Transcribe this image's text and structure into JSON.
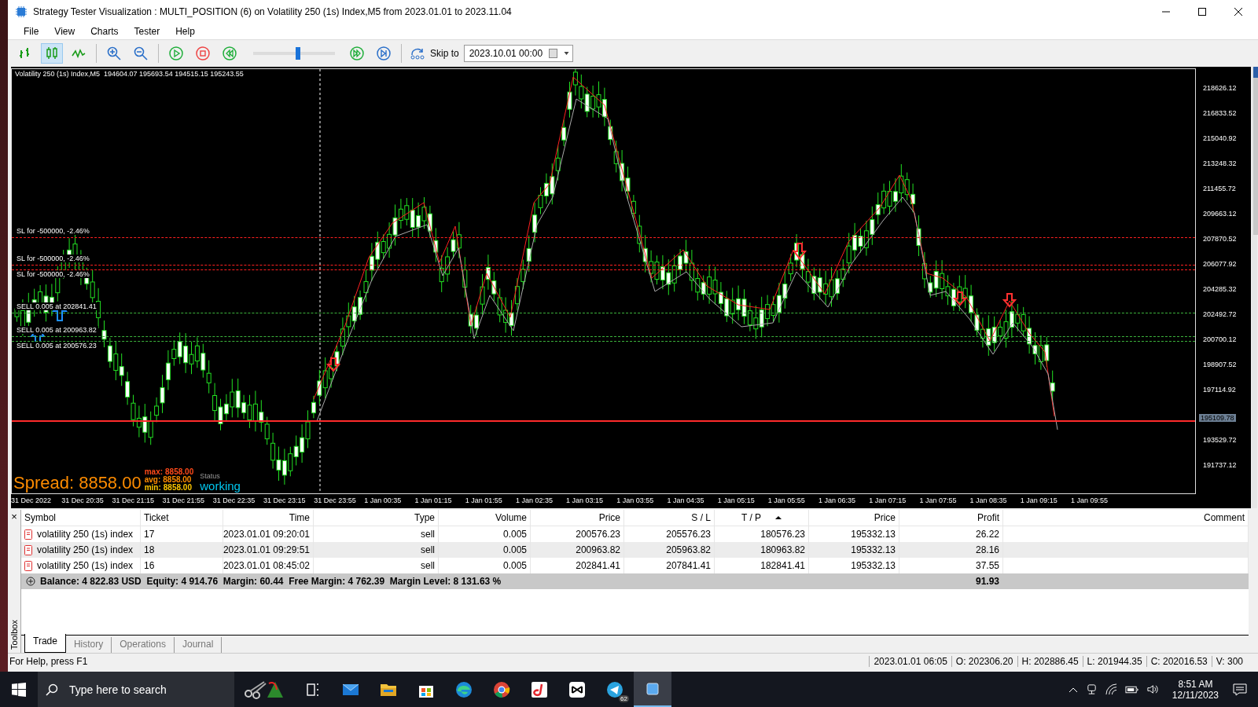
{
  "window": {
    "title": "Strategy Tester Visualization : MULTI_POSITION (6) on Volatility 250 (1s) Index,M5 from 2023.01.01 to 2023.11.04"
  },
  "menu": [
    "File",
    "View",
    "Charts",
    "Tester",
    "Help"
  ],
  "toolbar": {
    "items": [
      {
        "kind": "bars",
        "selected": false
      },
      {
        "kind": "candles",
        "selected": true
      },
      {
        "kind": "line",
        "selected": false
      },
      {
        "kind": "zoom-in"
      },
      {
        "kind": "zoom-out"
      },
      {
        "kind": "play"
      },
      {
        "kind": "stop"
      },
      {
        "kind": "rewind"
      },
      {
        "kind": "slider",
        "level": 0.55
      },
      {
        "kind": "fast-forward"
      },
      {
        "kind": "step-end"
      }
    ],
    "skip_label": "Skip to",
    "skip_date": "2023.10.01 00:00"
  },
  "chart": {
    "header": "Volatility 250 (1s) Index,M5  194604.07 195693.54 194515.15 195243.55",
    "levels": [
      {
        "label": "SL for -500000, -2.46%",
        "color": "#ff2020"
      },
      {
        "label": "SL for -500000, -2.46%",
        "color": "#ff2020"
      },
      {
        "label": "SL for -500000, -2.46%",
        "color": "#ff2020"
      },
      {
        "label": "SELL 0.005 at 202841.41",
        "color": "#3cb43c"
      },
      {
        "label": "SELL 0.005 at 200963.82",
        "color": "#3cb43c"
      },
      {
        "label": "SELL 0.005 at 200576.23",
        "color": "#3cb43c"
      }
    ],
    "current_price": "195109.78",
    "spread": "Spread: 8858.00",
    "stats": [
      {
        "label": "max:",
        "value": "8858.00",
        "color": "#ff4a1a"
      },
      {
        "label": "avg:",
        "value": "8858.00",
        "color": "#ff8c00"
      },
      {
        "label": "min:",
        "value": "8858.00",
        "color": "#ffc800"
      }
    ],
    "status_label": "Status",
    "status": "working",
    "y_ticks": [
      "218626.12",
      "216833.52",
      "215040.92",
      "213248.32",
      "211455.72",
      "209663.12",
      "207870.52",
      "206077.92",
      "204285.32",
      "202492.72",
      "200700.12",
      "198907.52",
      "197114.92",
      "193529.72",
      "191737.12"
    ],
    "x_ticks": [
      "31 Dec 2022",
      "31 Dec 20:35",
      "31 Dec 21:15",
      "31 Dec 21:55",
      "31 Dec 22:35",
      "31 Dec 23:15",
      "31 Dec 23:55",
      "1 Jan 00:35",
      "1 Jan 01:15",
      "1 Jan 01:55",
      "1 Jan 02:35",
      "1 Jan 03:15",
      "1 Jan 03:55",
      "1 Jan 04:35",
      "1 Jan 05:15",
      "1 Jan 05:55",
      "1 Jan 06:35",
      "1 Jan 07:15",
      "1 Jan 07:55",
      "1 Jan 08:35",
      "1 Jan 09:15",
      "1 Jan 09:55"
    ]
  },
  "toolbox": {
    "close": "×",
    "title": "Toolbox",
    "columns": [
      {
        "label": "Symbol",
        "sorted": false
      },
      {
        "label": "Ticket",
        "sorted": false
      },
      {
        "label": "Time",
        "sorted": false
      },
      {
        "label": "Type",
        "sorted": false
      },
      {
        "label": "Volume",
        "sorted": false
      },
      {
        "label": "Price",
        "sorted": false
      },
      {
        "label": "S / L",
        "sorted": false
      },
      {
        "label": "T / P",
        "sorted": true
      },
      {
        "label": "Price",
        "sorted": false
      },
      {
        "label": "Profit",
        "sorted": false
      },
      {
        "label": "Comment",
        "sorted": false
      }
    ],
    "rows": [
      [
        "volatility 250 (1s) index",
        "17",
        "2023.01.01 09:20:01",
        "sell",
        "0.005",
        "200576.23",
        "205576.23",
        "180576.23",
        "195332.13",
        "26.22"
      ],
      [
        "volatility 250 (1s) index",
        "18",
        "2023.01.01 09:29:51",
        "sell",
        "0.005",
        "200963.82",
        "205963.82",
        "180963.82",
        "195332.13",
        "28.16"
      ],
      [
        "volatility 250 (1s) index",
        "16",
        "2023.01.01 08:45:02",
        "sell",
        "0.005",
        "202841.41",
        "207841.41",
        "182841.41",
        "195332.13",
        "37.55"
      ]
    ],
    "summary": "Balance: 4 822.83 USD  Equity: 4 914.76  Margin: 60.44  Free Margin: 4 762.39  Margin Level: 8 131.63 %",
    "total": "91.93",
    "tabs": [
      {
        "label": "Trade",
        "selected": true
      },
      {
        "label": "History",
        "selected": false
      },
      {
        "label": "Operations",
        "selected": false
      },
      {
        "label": "Journal",
        "selected": false
      }
    ]
  },
  "status_bar": {
    "help": "For Help, press F1",
    "fields": [
      "2023.01.01 06:05",
      "O: 202306.20",
      "H: 202886.45",
      "L: 201944.35",
      "C: 202016.53",
      "V: 300"
    ]
  },
  "taskbar": {
    "search_placeholder": "Type here to search",
    "apps": [
      {
        "kind": "decoration",
        "active": false
      },
      {
        "kind": "task-view",
        "active": false
      },
      {
        "kind": "mail",
        "active": false
      },
      {
        "kind": "folder",
        "active": false
      },
      {
        "kind": "store",
        "active": false
      },
      {
        "kind": "edge",
        "active": false
      },
      {
        "kind": "chrome",
        "active": false
      },
      {
        "kind": "music",
        "active": false
      },
      {
        "kind": "capcut",
        "active": false
      },
      {
        "kind": "telegram",
        "active": false,
        "badge": "62"
      },
      {
        "kind": "terminal",
        "active": true
      }
    ],
    "time": "8:51 AM",
    "date": "12/11/2023"
  }
}
